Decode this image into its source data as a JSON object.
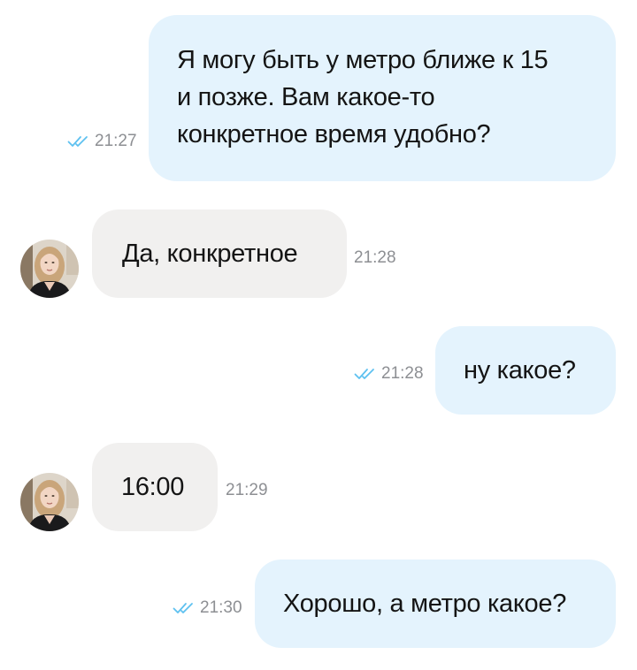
{
  "colors": {
    "outgoing_bubble": "#e4f3fd",
    "incoming_bubble": "#f1f0ef",
    "read_ticks": "#5ec1f0",
    "time_text": "#8d8f93"
  },
  "messages": [
    {
      "direction": "outgoing",
      "text": "Я могу быть у метро ближе к 15\nи позже. Вам какое-то\nконкретное время удобно?",
      "time": "21:27",
      "status_icon": "double-check-read-icon"
    },
    {
      "direction": "incoming",
      "text": "Да, конкретное",
      "time": "21:28",
      "avatar_icon": "contact-avatar"
    },
    {
      "direction": "outgoing",
      "text": "ну какое?",
      "time": "21:28",
      "status_icon": "double-check-read-icon"
    },
    {
      "direction": "incoming",
      "text": "16:00",
      "time": "21:29",
      "avatar_icon": "contact-avatar"
    },
    {
      "direction": "outgoing",
      "text": "Хорошо, а метро какое?",
      "time": "21:30",
      "status_icon": "double-check-read-icon"
    }
  ]
}
